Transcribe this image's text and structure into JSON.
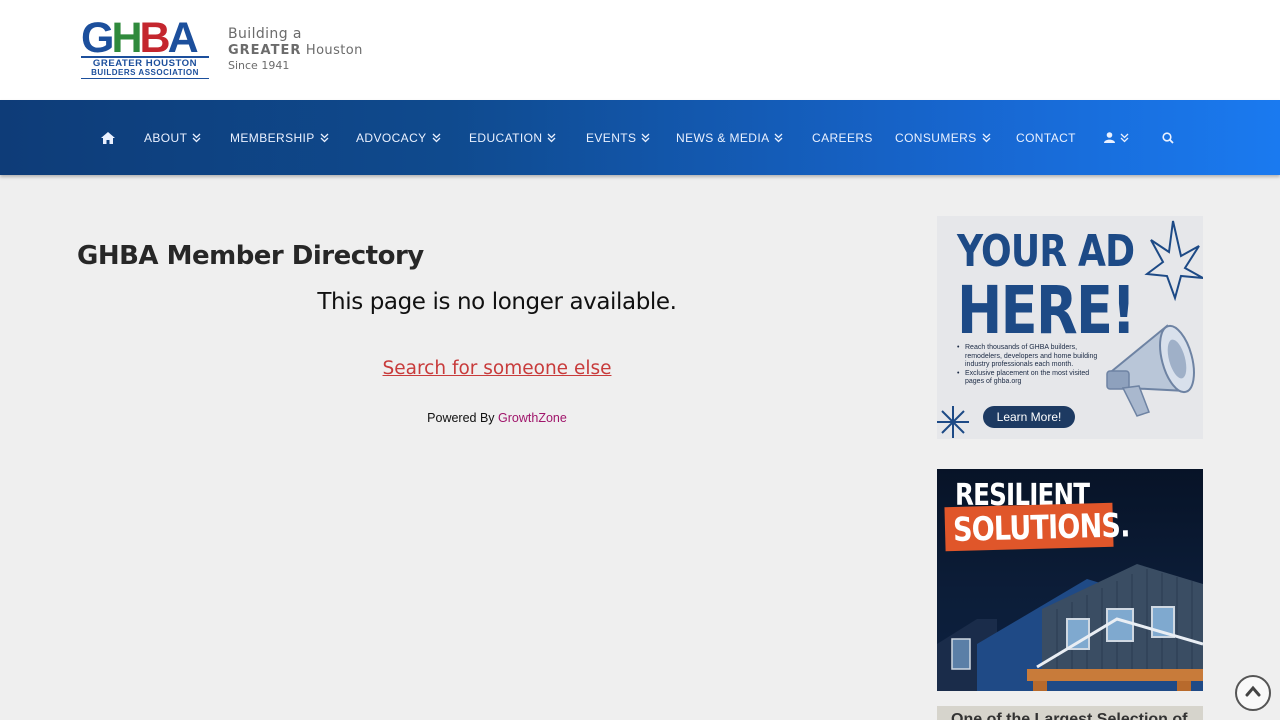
{
  "header": {
    "logo": {
      "letters": "GHBA",
      "line1": "GREATER HOUSTON",
      "line2": "BUILDERS ASSOCIATION"
    },
    "tagline": {
      "line1": "Building a",
      "line2_bold": "GREATER",
      "line2_rest": " Houston",
      "line3": "Since 1941"
    }
  },
  "nav": {
    "home_icon": "home-icon",
    "items": [
      {
        "label": "ABOUT",
        "dropdown": true
      },
      {
        "label": "MEMBERSHIP",
        "dropdown": true
      },
      {
        "label": "ADVOCACY",
        "dropdown": true
      },
      {
        "label": "EDUCATION",
        "dropdown": true
      },
      {
        "label": "EVENTS",
        "dropdown": true
      },
      {
        "label": "NEWS & MEDIA",
        "dropdown": true
      },
      {
        "label": "CAREERS",
        "dropdown": false
      },
      {
        "label": "CONSUMERS",
        "dropdown": true
      },
      {
        "label": "CONTACT",
        "dropdown": false
      }
    ],
    "user_icon": "user-icon",
    "search_icon": "search-icon",
    "gradient_start": "#0e3c78",
    "gradient_end": "#1a7af0"
  },
  "main": {
    "title": "GHBA Member Directory",
    "message": "This page is no longer available.",
    "search_link": "Search for someone else",
    "powered_by": "Powered By",
    "powered_link": "GrowthZone",
    "link_color": "#c83b3b",
    "powered_color": "#a0156b"
  },
  "sidebar": {
    "ad1": {
      "headline_a": "YOUR AD",
      "headline_b": "HERE!",
      "bullets": [
        "Reach thousands of GHBA builders, remodelers, developers and home building industry professionals each month.",
        "Exclusive placement on the most visited pages of ghba.org"
      ],
      "button": "Learn More!"
    },
    "ad2": {
      "line1": "RESILIENT",
      "line2": "SOLUTIONS."
    },
    "ad3": {
      "text": "One of the Largest Selection of"
    }
  },
  "back_to_top_icon": "chevron-up-icon"
}
